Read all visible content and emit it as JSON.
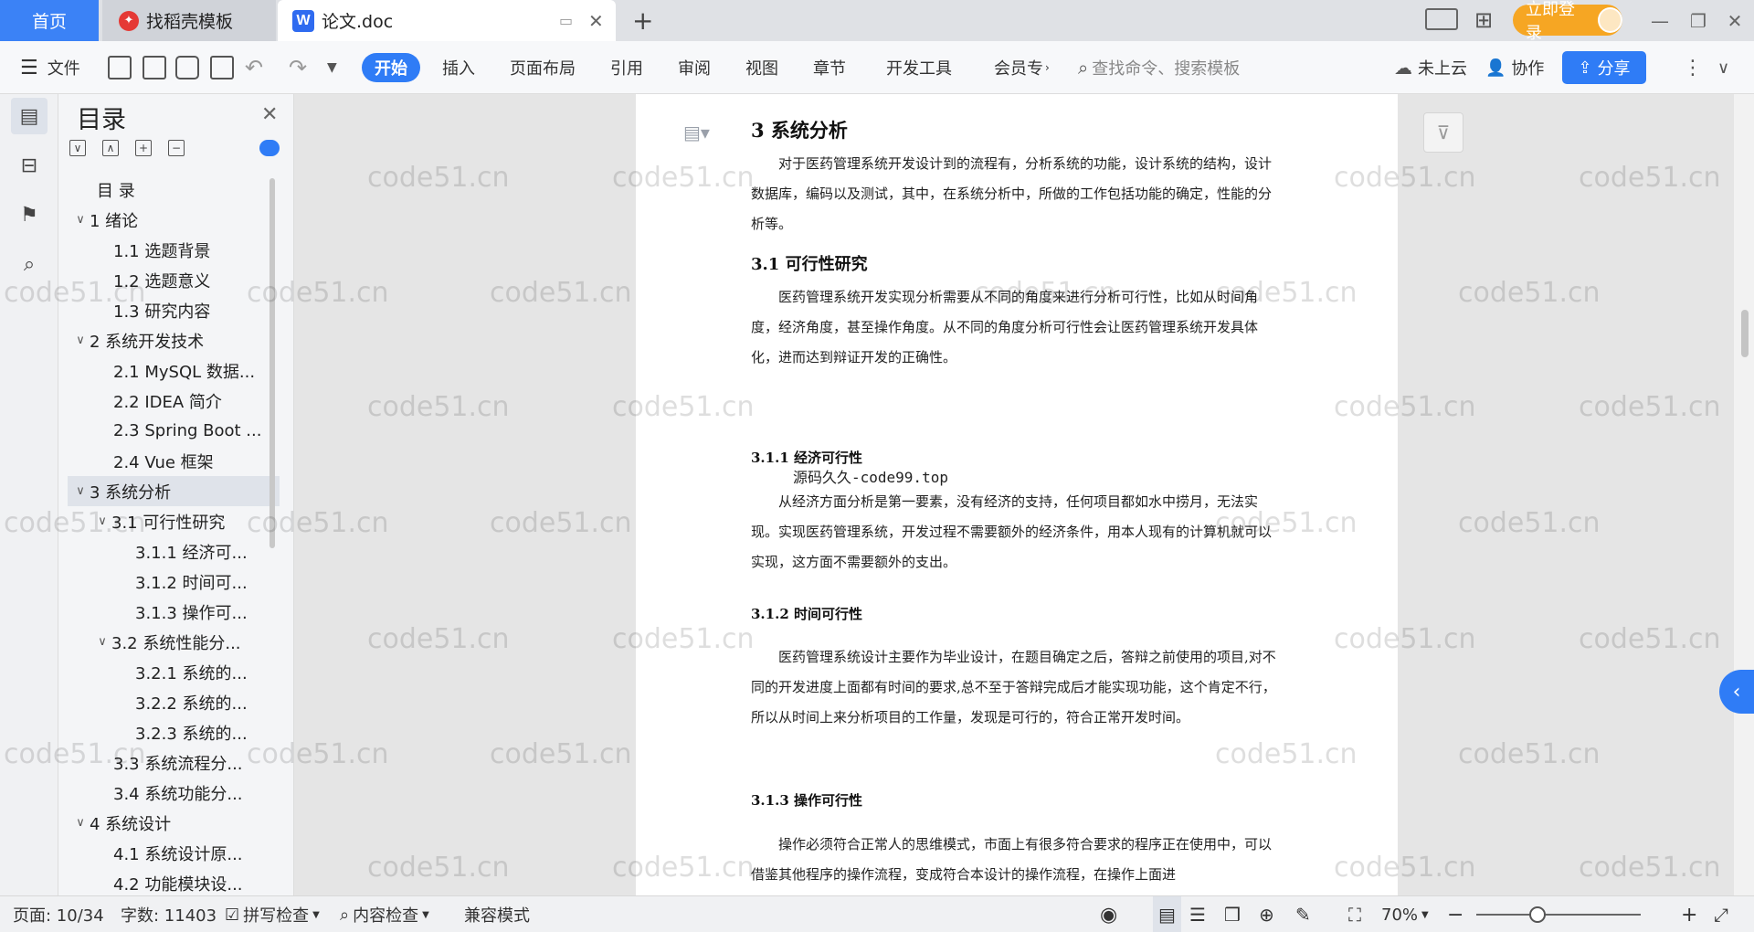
{
  "tabs": {
    "home": "首页",
    "template": "找稻壳模板",
    "doc": "论文.doc",
    "login": "立即登录"
  },
  "toolbar": {
    "file": "文件",
    "tabs": [
      "开始",
      "插入",
      "页面布局",
      "引用",
      "审阅",
      "视图",
      "章节",
      "开发工具",
      "会员专"
    ],
    "search_placeholder": "查找命令、搜索模板",
    "cloud": "未上云",
    "collab": "协作",
    "share": "分享"
  },
  "toc": {
    "title": "目录",
    "items": [
      {
        "label": "目   录"
      },
      {
        "label": "1  绪论"
      },
      {
        "label": "1.1  选题背景"
      },
      {
        "label": "1.2  选题意义"
      },
      {
        "label": "1.3  研究内容"
      },
      {
        "label": "2  系统开发技术"
      },
      {
        "label": "2.1 MySQL 数据..."
      },
      {
        "label": "2.2 IDEA 简介"
      },
      {
        "label": "2.3 Spring Boot ..."
      },
      {
        "label": "2.4 Vue 框架"
      },
      {
        "label": "3  系统分析"
      },
      {
        "label": "3.1  可行性研究"
      },
      {
        "label": "3.1.1  经济可..."
      },
      {
        "label": "3.1.2  时间可..."
      },
      {
        "label": "3.1.3  操作可..."
      },
      {
        "label": "3.2  系统性能分..."
      },
      {
        "label": "3.2.1  系统的..."
      },
      {
        "label": "3.2.2  系统的..."
      },
      {
        "label": "3.2.3  系统的..."
      },
      {
        "label": "3.3  系统流程分..."
      },
      {
        "label": "3.4  系统功能分..."
      },
      {
        "label": "4  系统设计"
      },
      {
        "label": "4.1  系统设计原..."
      },
      {
        "label": "4.2  功能模块设..."
      }
    ]
  },
  "doc": {
    "h_3": "3  系统分析",
    "p_3": "对于医药管理系统开发设计到的流程有，分析系统的功能，设计系统的结构，设计数据库，编码以及测试，其中，在系统分析中，所做的工作包括功能的确定，性能的分析等。",
    "h_31": "3.1  可行性研究",
    "p_31": "医药管理系统开发实现分析需要从不同的角度来进行分析可行性，比如从时间角度，经济角度，甚至操作角度。从不同的角度分析可行性会让医药管理系统开发具体化，进而达到辩证开发的正确性。",
    "h_311": "3.1.1  经济可行性",
    "mono_note": "源码久久-code99.top",
    "p_311": "从经济方面分析是第一要素，没有经济的支持，任何项目都如水中捞月，无法实现。实现医药管理系统，开发过程不需要额外的经济条件，用本人现有的计算机就可以实现，这方面不需要额外的支出。",
    "h_312": "3.1.2  时间可行性",
    "p_312": "医药管理系统设计主要作为毕业设计，在题目确定之后，答辩之前使用的项目,对不同的开发进度上面都有时间的要求,总不至于答辩完成后才能实现功能，这个肯定不行，所以从时间上来分析项目的工作量，发现是可行的，符合正常开发时间。",
    "h_313": "3.1.3  操作可行性",
    "p_313": "操作必须符合正常人的思维模式，市面上有很多符合要求的程序正在使用中，可以借鉴其他程序的操作流程，变成符合本设计的操作流程，在操作上面进"
  },
  "watermark": "code51.cn",
  "status": {
    "page": "页面: 10/34",
    "words": "字数: 11403",
    "spell": "拼写检查",
    "content": "内容检查",
    "compat": "兼容模式",
    "zoom": "70%"
  }
}
